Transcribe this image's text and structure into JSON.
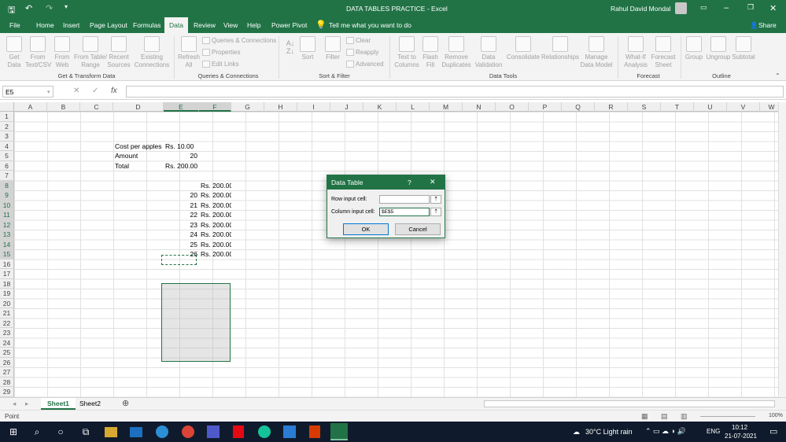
{
  "window": {
    "title": "DATA TABLES PRACTICE  -  Excel",
    "user": "Rahul David Mondal"
  },
  "menu_tabs": [
    "File",
    "Home",
    "Insert",
    "Page Layout",
    "Formulas",
    "Data",
    "Review",
    "View",
    "Help",
    "Power Pivot"
  ],
  "active_tab": "Data",
  "tell_me": "Tell me what you want to do",
  "share_label": "Share",
  "ribbon": {
    "get_data": "Get\nData",
    "from_text": "From\nText/CSV",
    "from_web": "From\nWeb",
    "from_table": "From Table/\nRange",
    "recent_sources": "Recent\nSources",
    "existing_connections": "Existing\nConnections",
    "refresh_all": "Refresh\nAll",
    "queries_connections": "Queries & Connections",
    "properties": "Properties",
    "edit_links": "Edit Links",
    "sort": "Sort",
    "filter": "Filter",
    "clear": "Clear",
    "reapply": "Reapply",
    "advanced": "Advanced",
    "text_to_columns": "Text to\nColumns",
    "flash_fill": "Flash\nFill",
    "remove_duplicates": "Remove\nDuplicates",
    "data_validation": "Data\nValidation",
    "consolidate": "Consolidate",
    "relationships": "Relationships",
    "manage_data_model": "Manage\nData Model",
    "what_if": "What-If\nAnalysis",
    "forecast_sheet": "Forecast\nSheet",
    "group": "Group",
    "ungroup": "Ungroup",
    "subtotal": "Subtotal",
    "groups": [
      "Get & Transform Data",
      "Queries & Connections",
      "Sort & Filter",
      "Data Tools",
      "Forecast",
      "Outline"
    ]
  },
  "formula_bar": {
    "name_box": "E5",
    "formula": "",
    "fx": "fx"
  },
  "columns": [
    "A",
    "B",
    "C",
    "D",
    "E",
    "F",
    "G",
    "H",
    "I",
    "J",
    "K",
    "L",
    "M",
    "N",
    "O",
    "P",
    "Q",
    "R",
    "S",
    "T",
    "U",
    "V",
    "W"
  ],
  "rows": [
    "1",
    "2",
    "3",
    "4",
    "5",
    "6",
    "7",
    "8",
    "9",
    "10",
    "11",
    "12",
    "13",
    "14",
    "15",
    "16",
    "17",
    "18",
    "19",
    "20",
    "21",
    "22",
    "23",
    "24",
    "25",
    "26",
    "27",
    "28",
    "29"
  ],
  "cells": {
    "D4": "Cost per apples",
    "E4": "Rs. 10.00",
    "D5": "Amount",
    "E5": "20",
    "D6": "Total",
    "E6": "Rs. 200.00",
    "F8": "Rs. 200.00",
    "E9": "20",
    "F9": "Rs. 200.00",
    "E10": "21",
    "F10": "Rs. 200.00",
    "E11": "22",
    "F11": "Rs. 200.00",
    "E12": "23",
    "F12": "Rs. 200.00",
    "E13": "24",
    "F13": "Rs. 200.00",
    "E14": "25",
    "F14": "Rs. 200.00",
    "E15": "26",
    "F15": "Rs. 200.00"
  },
  "dialog": {
    "title": "Data Table",
    "help": "?",
    "row_label": "Row input cell:",
    "row_value": "",
    "col_label": "Column input cell:",
    "col_value": "$E$5",
    "ok": "OK",
    "cancel": "Cancel"
  },
  "sheets": [
    "Sheet1",
    "Sheet2"
  ],
  "active_sheet": "Sheet1",
  "status": {
    "mode": "Point",
    "zoom": "100%"
  },
  "taskbar": {
    "weather": "30°C  Light rain",
    "lang": "ENG",
    "time": "10:12",
    "date": "21-07-2021"
  }
}
